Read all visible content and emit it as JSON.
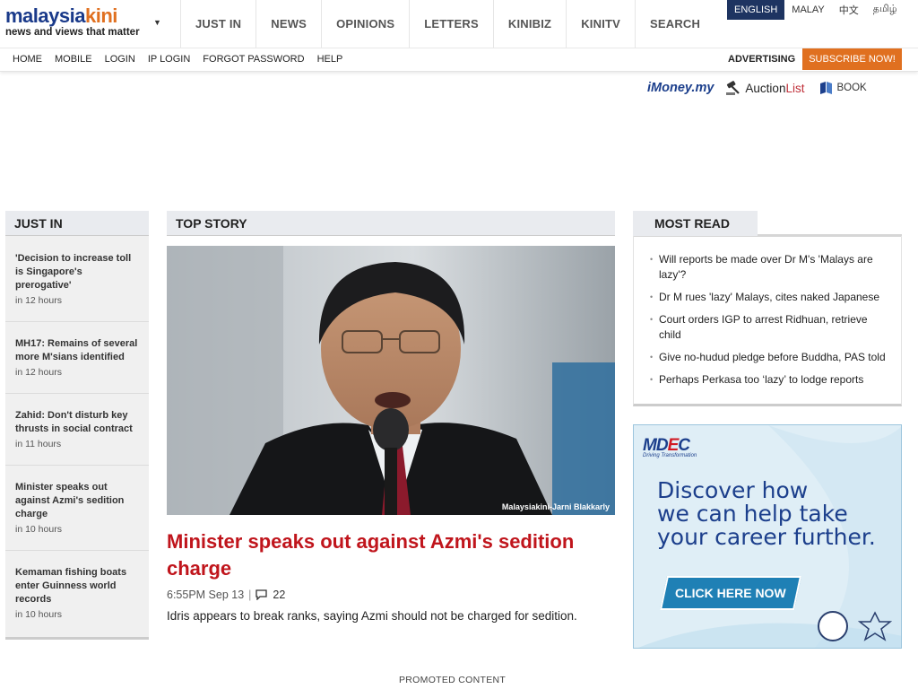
{
  "logo": {
    "word_a": "malaysia",
    "word_b": "kini",
    "tagline": "news and views that matter"
  },
  "main_nav": [
    "JUST IN",
    "NEWS",
    "OPINIONS",
    "LETTERS",
    "KINIBIZ",
    "KINITV",
    "SEARCH"
  ],
  "languages": [
    "ENGLISH",
    "MALAY",
    "中文",
    "தமிழ்"
  ],
  "sub_nav": [
    "HOME",
    "MOBILE",
    "LOGIN",
    "IP LOGIN",
    "FORGOT PASSWORD",
    "HELP"
  ],
  "advertising": "ADVERTISING",
  "subscribe": "SUBSCRIBE NOW!",
  "partners": {
    "imoney_a": "iMoney",
    "imoney_b": ".my",
    "auction_a": "Auction",
    "auction_b": "List",
    "book": "BOOK"
  },
  "just_in": {
    "heading": "JUST IN",
    "items": [
      {
        "title": "'Decision to increase toll is Singapore's prerogative'",
        "time": "in 12 hours"
      },
      {
        "title": "MH17: Remains of several more M'sians identified",
        "time": "in 12 hours"
      },
      {
        "title": "Zahid: Don't disturb key thrusts in social contract",
        "time": "in 11 hours"
      },
      {
        "title": "Minister speaks out against Azmi's sedition charge",
        "time": "in 10 hours"
      },
      {
        "title": "Kemaman fishing boats enter Guinness world records",
        "time": "in 10 hours"
      }
    ]
  },
  "top_story": {
    "heading": "TOP STORY",
    "photo_credit": "Malaysiakini-Jarni Blakkarly",
    "title": "Minister speaks out against Azmi's sedition charge",
    "time": "6:55PM Sep 13",
    "comments": "22",
    "description": "Idris appears to break ranks, saying Azmi should not be charged for sedition."
  },
  "most_read": {
    "heading": "MOST READ",
    "items": [
      "Will reports be made over Dr M's 'Malays are lazy'?",
      "Dr M rues 'lazy' Malays, cites naked Japanese",
      "Court orders IGP to arrest Ridhuan, retrieve child",
      "Give no-hudud pledge before Buddha, PAS told",
      "Perhaps Perkasa too ‘lazy’ to lodge reports"
    ]
  },
  "ad": {
    "logo_a": "MD",
    "logo_b": "E",
    "logo_c": "C",
    "logo_sub": "Driving Transformation",
    "line1": "Discover how",
    "line2": "we can help take",
    "line3": "your career further.",
    "button": "CLICK HERE NOW"
  },
  "promoted": "PROMOTED CONTENT",
  "colors": {
    "brand_blue": "#1a3a8a",
    "brand_orange": "#e07020",
    "headline_red": "#c0151c",
    "nav_active": "#1e3461"
  }
}
